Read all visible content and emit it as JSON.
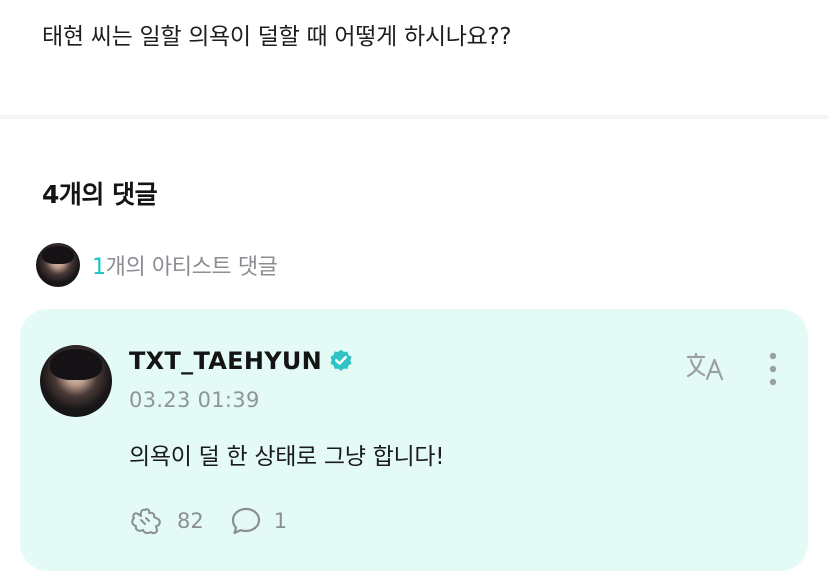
{
  "post": {
    "question": "태현 씨는 일할 의욕이 덜할 때 어떻게 하시나요??"
  },
  "comments": {
    "heading": "4개의 댓글",
    "artist_summary": {
      "count": "1",
      "label": "개의 아티스트 댓글"
    }
  },
  "comment": {
    "author": "TXT_TAEHYUN",
    "verified_icon": "verified-badge-icon",
    "timestamp": "03.23 01:39",
    "body": "의욕이 덜 한 상태로 그냥 합니다!",
    "likes": "82",
    "replies": "1",
    "icons": {
      "translate": "translate-icon",
      "more": "more-vertical-icon",
      "like": "like-icon",
      "reply": "comment-bubble-icon"
    }
  },
  "colors": {
    "accent": "#17c4c7",
    "verified": "#2ec3c5",
    "card_background": "#e3faf6",
    "muted_text": "#8a8d92"
  }
}
